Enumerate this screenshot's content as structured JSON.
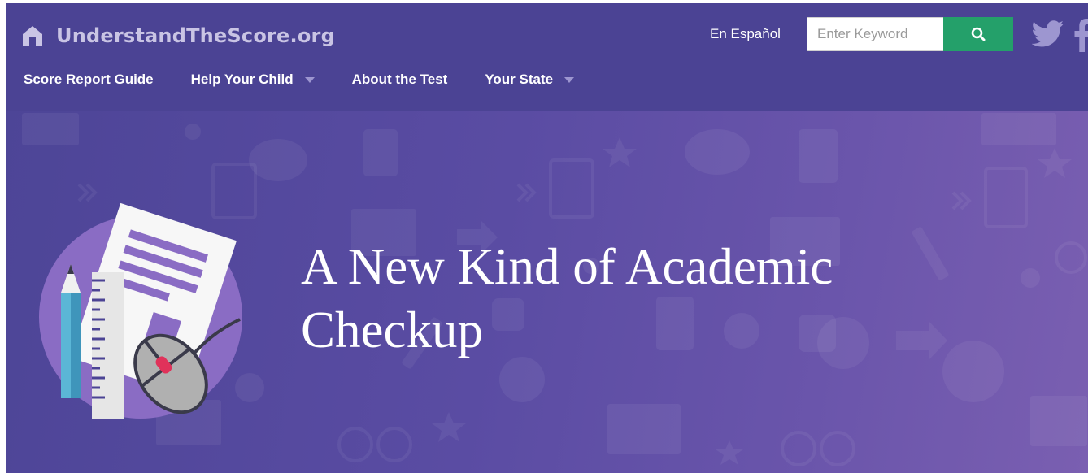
{
  "site": {
    "logo_text": "UnderstandTheScore.org",
    "home_icon": "home-icon"
  },
  "header": {
    "language_link": "En Español",
    "search": {
      "placeholder": "Enter Keyword",
      "button_icon": "search-icon"
    },
    "social": [
      "twitter-icon",
      "facebook-icon"
    ]
  },
  "nav": {
    "items": [
      {
        "label": "Score Report Guide",
        "has_dropdown": false
      },
      {
        "label": "Help Your Child",
        "has_dropdown": true
      },
      {
        "label": "About the Test",
        "has_dropdown": false
      },
      {
        "label": "Your State",
        "has_dropdown": true
      }
    ]
  },
  "hero": {
    "title_line1": "A New Kind of Academic",
    "title_line2": "Checkup"
  },
  "colors": {
    "header_bg": "#4b4394",
    "hero_bg": "#5a4ca3",
    "search_button": "#24a06a",
    "logo_text": "#c9c4e4"
  }
}
